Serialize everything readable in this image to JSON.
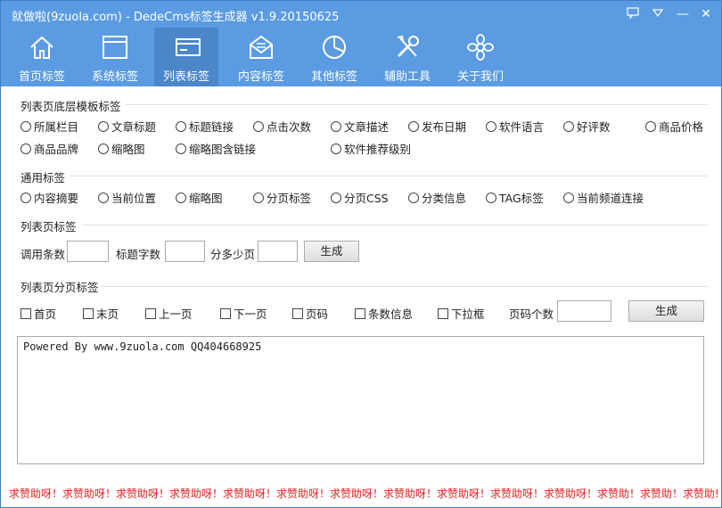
{
  "window": {
    "title": "就做啦(9zuola.com) - DedeCms标签生成器 v1.9.20150625",
    "controls": {
      "chat_icon": "chat-icon",
      "menu_icon": "dropdown-icon",
      "min": "—",
      "close": "✕"
    }
  },
  "toolbar": {
    "tabs": [
      {
        "label": "首页标签",
        "icon": "home-icon"
      },
      {
        "label": "系统标签",
        "icon": "window-icon"
      },
      {
        "label": "列表标签",
        "icon": "card-icon",
        "active": true
      },
      {
        "label": "内容标签",
        "icon": "envelope-icon"
      },
      {
        "label": "其他标签",
        "icon": "pie-chart-icon"
      },
      {
        "label": "辅助工具",
        "icon": "tools-icon"
      },
      {
        "label": "关于我们",
        "icon": "flower-icon"
      }
    ]
  },
  "sections": {
    "base": {
      "title": "列表页底层模板标签",
      "row1": [
        "所属栏目",
        "文章标题",
        "标题链接",
        "点击次数",
        "文章描述",
        "发布日期",
        "软件语言",
        "好评数",
        "商品价格"
      ],
      "row2": [
        "商品品牌",
        "缩略图",
        "缩略图含链接",
        "软件推荐级别"
      ]
    },
    "common": {
      "title": "通用标签",
      "items": [
        "内容摘要",
        "当前位置",
        "缩略图",
        "分页标签",
        "分页CSS",
        "分类信息",
        "TAG标签",
        "当前频道连接"
      ]
    },
    "list": {
      "title": "列表页标签",
      "count_label": "调用条数",
      "count_value": "",
      "title_len_label": "标题字数",
      "title_len_value": "",
      "per_page_label": "分多少页",
      "per_page_value": "",
      "generate": "生成"
    },
    "paging": {
      "title": "列表页分页标签",
      "items": [
        "首页",
        "末页",
        "上一页",
        "下一页",
        "页码",
        "条数信息",
        "下拉框"
      ],
      "page_num_label": "页码个数",
      "page_num_value": "",
      "generate": "生成"
    }
  },
  "output": {
    "text": "Powered By www.9zuola.com QQ404668925"
  },
  "footer": {
    "text": "求赞助呀！求赞助呀！求赞助呀！求赞助呀！求赞助呀！求赞助呀！求赞助呀！求赞助呀！求赞助呀！求赞助呀！求赞助呀！求赞助！求赞助！求赞助!"
  }
}
